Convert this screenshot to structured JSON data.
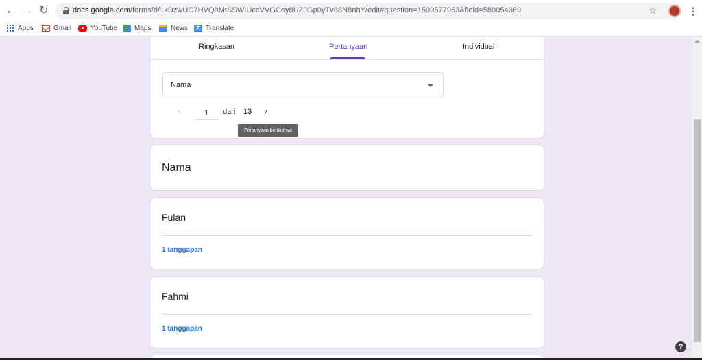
{
  "browser": {
    "url_host": "docs.google.com",
    "url_path": "/forms/d/1kDzwUC7HVQ8MtSSWIUccVVGCoy8UZJGp0yTv88N8nhY/edit#question=1509577953&field=580054369",
    "bookmarks": [
      "Apps",
      "Gmail",
      "YouTube",
      "Maps",
      "News",
      "Translate"
    ]
  },
  "tabs": {
    "summary": "Ringkasan",
    "question": "Pertanyaan",
    "individual": "Individual"
  },
  "question_select": {
    "selected": "Nama"
  },
  "pager": {
    "current": "1",
    "of_label": "dari",
    "total": "13",
    "next_tooltip": "Pertanyaan berikutnya"
  },
  "question": {
    "title": "Nama"
  },
  "responses": [
    {
      "answer": "Fulan",
      "count": "1 tanggapan"
    },
    {
      "answer": "Fahmi",
      "count": "1 tanggapan"
    }
  ]
}
